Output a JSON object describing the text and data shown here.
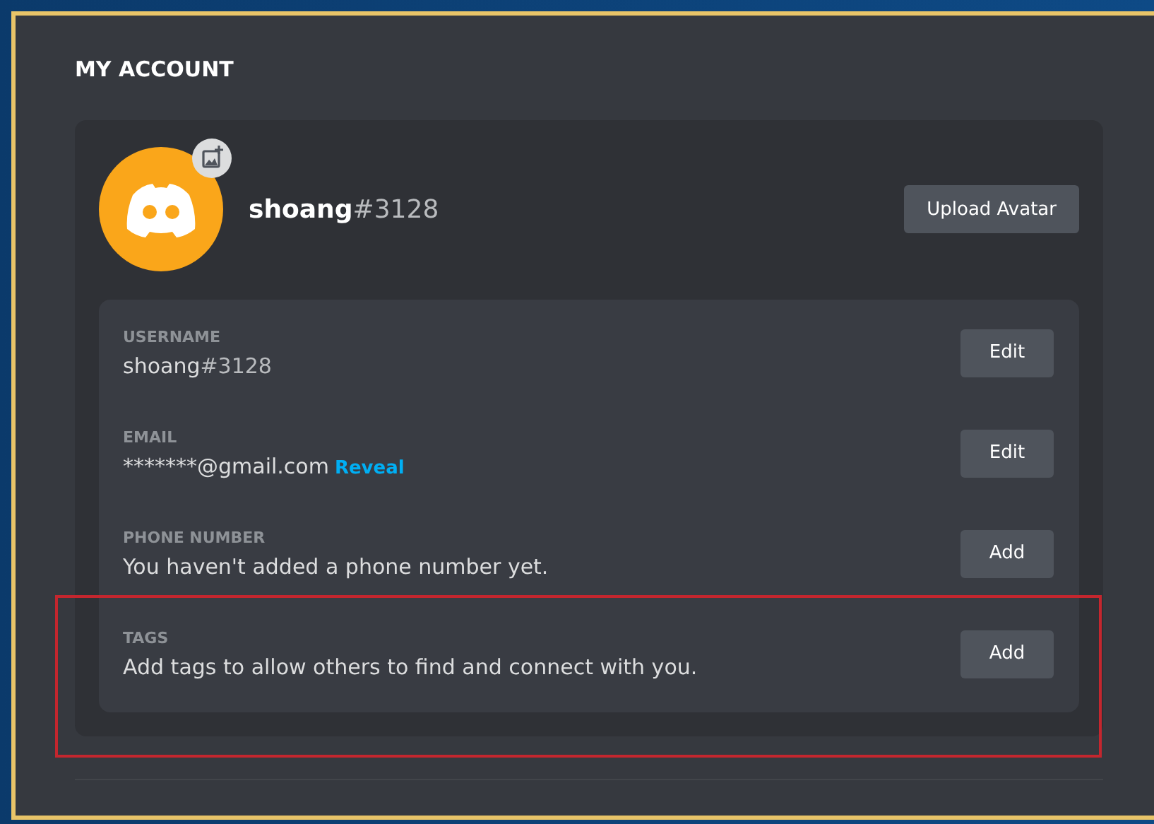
{
  "section_title": "MY ACCOUNT",
  "profile": {
    "username": "shoang",
    "discriminator": "#3128",
    "upload_button": "Upload Avatar"
  },
  "fields": [
    {
      "label": "USERNAME",
      "value": "shoang",
      "suffix": "#3128",
      "button": "Edit",
      "highlighted": false
    },
    {
      "label": "EMAIL",
      "value": "*******@gmail.com",
      "link": "Reveal",
      "button": "Edit",
      "highlighted": false
    },
    {
      "label": "PHONE NUMBER",
      "value": "You haven't added a phone number yet.",
      "button": "Add",
      "highlighted": false
    },
    {
      "label": "TAGS",
      "value": "Add tags to allow others to find and connect with you.",
      "button": "Add",
      "highlighted": true
    }
  ]
}
